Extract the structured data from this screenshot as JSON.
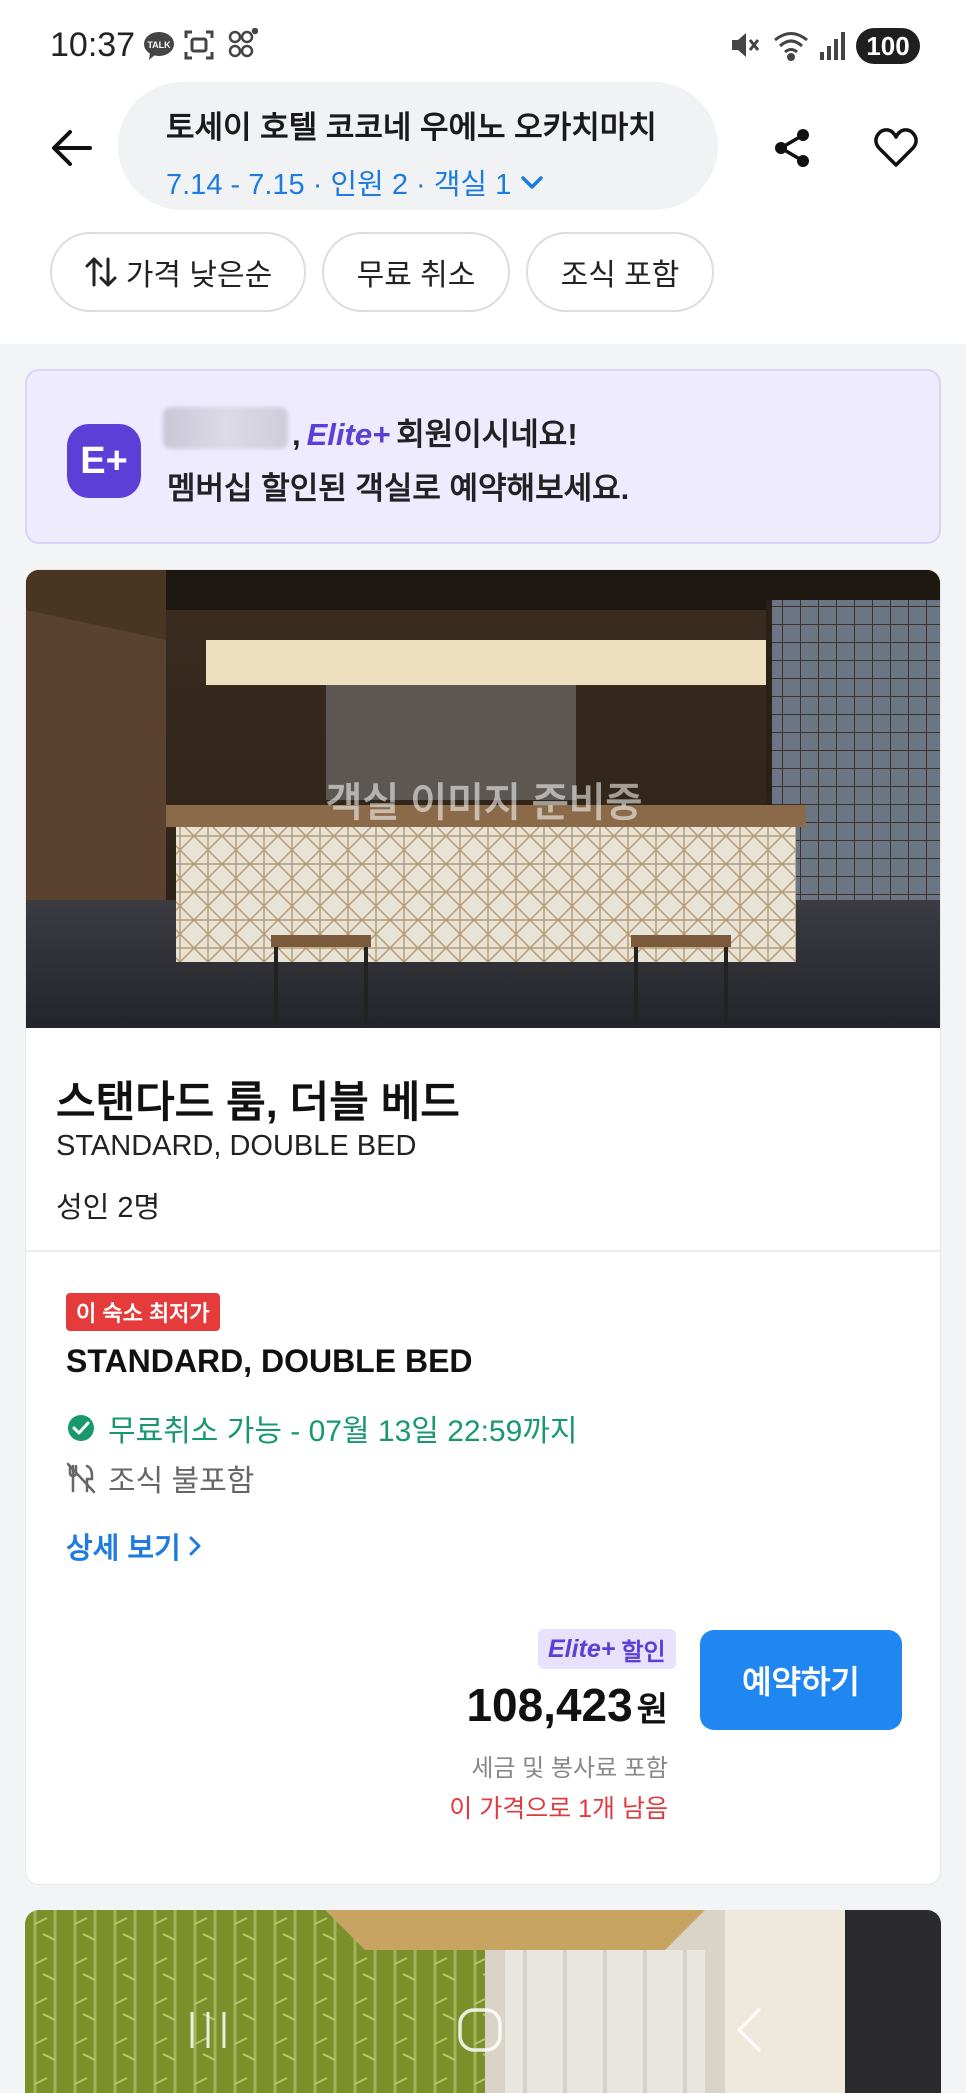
{
  "status_bar": {
    "time": "10:37",
    "battery": "100",
    "icons": [
      "talk-icon",
      "screenshot-icon",
      "app-icon",
      "mute-icon",
      "wifi-icon",
      "signal-icon"
    ]
  },
  "header": {
    "hotel_name": "토세이 호텔 코코네 우에노 오카치마치",
    "trip_summary": "7.14 - 7.15 · 인원 2 · 객실 1",
    "accent_color": "#1e7be0"
  },
  "filters": [
    {
      "label": "가격 낮은순"
    },
    {
      "label": "무료 취소"
    },
    {
      "label": "조식 포함"
    }
  ],
  "elite_banner": {
    "logo": "E+",
    "comma": ",",
    "elite_word": "Elite+",
    "line1_suffix": "회원이시네요!",
    "line2": "멤버십 할인된 객실로 예약해보세요.",
    "brand_color": "#5b3fd6"
  },
  "room": {
    "image_placeholder": "객실 이미지 준비중",
    "title": "스탠다드 룸, 더블 베드",
    "subtitle": "STANDARD, DOUBLE BED",
    "capacity": "성인 2명",
    "rate": {
      "badge": "이 숙소 최저가",
      "name": "STANDARD, DOUBLE BED",
      "cancellation": "무료취소 가능 - 07월 13일 22:59까지",
      "breakfast": "조식 불포함",
      "details_link": "상세 보기",
      "discount_elite": "Elite+",
      "discount_label": "할인",
      "price": "108,423",
      "currency": "원",
      "tax_note": "세금 및 봉사료 포함",
      "remaining": "이 가격으로 1개 남음",
      "book_label": "예약하기",
      "book_color": "#1f86f2"
    }
  },
  "nav_bar": {
    "buttons": [
      "recent-apps-icon",
      "home-icon",
      "back-nav-icon"
    ]
  }
}
